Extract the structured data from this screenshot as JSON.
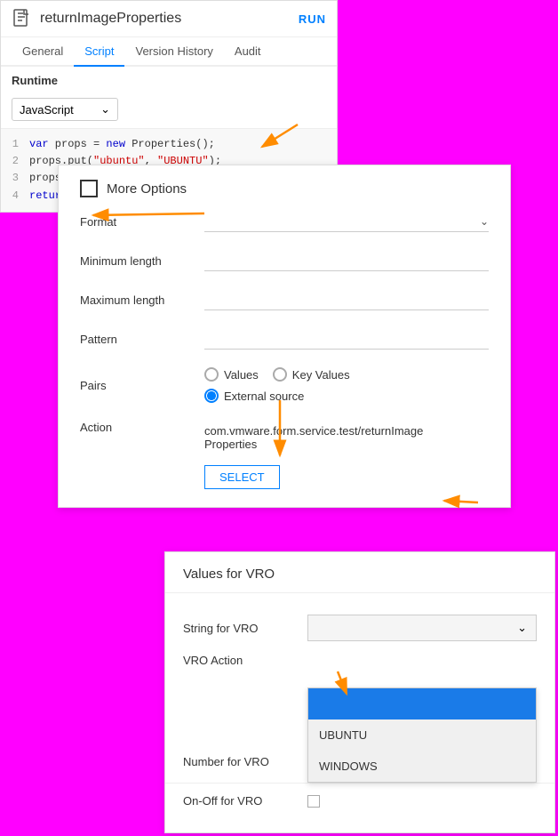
{
  "app": {
    "title": "returnImageProperties",
    "run_label": "RUN",
    "icon": "script-icon"
  },
  "tabs": [
    {
      "label": "General",
      "active": false
    },
    {
      "label": "Script",
      "active": true
    },
    {
      "label": "Version History",
      "active": false
    },
    {
      "label": "Audit",
      "active": false
    }
  ],
  "runtime": {
    "label": "Runtime",
    "value": "JavaScript"
  },
  "code": {
    "lines": [
      {
        "num": "1",
        "content": "var props = new Properties();"
      },
      {
        "num": "2",
        "content": "props.put(\"ubuntu\", \"UBUNTU\");"
      },
      {
        "num": "3",
        "content": "props.put(\"windows\", \"WINDOWS\");"
      },
      {
        "num": "4",
        "content": "return props;"
      }
    ]
  },
  "more_options": {
    "title": "More Options",
    "format": {
      "label": "Format",
      "value": ""
    },
    "min_length": {
      "label": "Minimum length",
      "value": ""
    },
    "max_length": {
      "label": "Maximum length",
      "value": ""
    },
    "pattern": {
      "label": "Pattern",
      "value": ""
    },
    "pairs": {
      "label": "Pairs",
      "options": [
        "Values",
        "Key Values",
        "External source"
      ],
      "selected": "External source"
    },
    "action": {
      "label": "Action",
      "value": "com.vmware.form.service.test/returnImage",
      "value2": "Properties"
    },
    "select_label": "SELECT"
  },
  "vro": {
    "title": "Values for VRO",
    "string_for_vro": {
      "label": "String for VRO",
      "value": ""
    },
    "vro_action": {
      "label": "VRO Action",
      "dropdown_items": [
        {
          "value": "",
          "highlighted": true
        },
        {
          "value": "UBUNTU",
          "highlighted": false
        },
        {
          "value": "WINDOWS",
          "highlighted": false
        }
      ]
    },
    "number_for_vro": {
      "label": "Number for VRO",
      "value": ""
    },
    "on_off_for_vro": {
      "label": "On-Off for VRO"
    }
  }
}
